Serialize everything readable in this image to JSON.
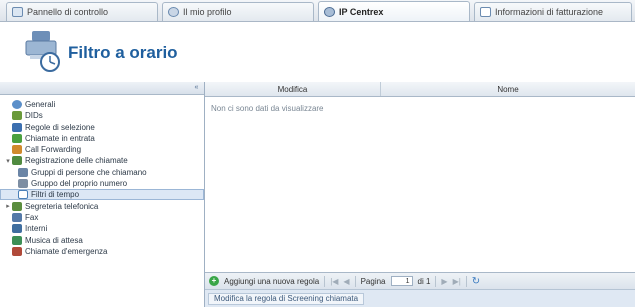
{
  "tabs": [
    {
      "label": "Pannello di controllo",
      "icon": "panel-icon",
      "active": false
    },
    {
      "label": "Il mio profilo",
      "icon": "user-icon",
      "active": false
    },
    {
      "label": "IP Centrex",
      "icon": "gear-icon",
      "active": true
    },
    {
      "label": "Informazioni di fatturazione",
      "icon": "info-icon",
      "active": false
    }
  ],
  "header": {
    "title": "Filtro a orario",
    "icon": "clock-filter-icon"
  },
  "sidebar": {
    "collapse_symbol": "«",
    "items": [
      {
        "label": "Generali",
        "icon": "globe-icon",
        "color": "#5b8fc9"
      },
      {
        "label": "DIDs",
        "icon": "phone-number-icon",
        "color": "#6a9a3a"
      },
      {
        "label": "Regole di selezione",
        "icon": "rules-icon",
        "color": "#3b6fb0"
      },
      {
        "label": "Chiamate in entrata",
        "icon": "incoming-call-icon",
        "color": "#4aa03f"
      },
      {
        "label": "Call Forwarding",
        "icon": "forward-icon",
        "color": "#d08a2c"
      },
      {
        "label": "Registrazione delle chiamate",
        "icon": "recording-icon",
        "color": "#4f8a3f",
        "toggle": "▾"
      },
      {
        "label": "Gruppi di persone che chiamano",
        "icon": "group-icon",
        "color": "#6b85a6"
      },
      {
        "label": "Gruppo del proprio numero",
        "icon": "grid-icon",
        "color": "#7d8ea3"
      },
      {
        "label": "Filtri di tempo",
        "icon": "clock-icon",
        "color": "#4a7fb8",
        "selected": true
      },
      {
        "label": "Segreteria telefonica",
        "icon": "voicemail-icon",
        "color": "#5a8d3e",
        "toggle": "▸"
      },
      {
        "label": "Fax",
        "icon": "fax-icon",
        "color": "#5479a8"
      },
      {
        "label": "Interni",
        "icon": "extensions-icon",
        "color": "#3f6e9f"
      },
      {
        "label": "Musica di attesa",
        "icon": "music-icon",
        "color": "#3c8f56"
      },
      {
        "label": "Chiamate d'emergenza",
        "icon": "emergency-icon",
        "color": "#b04a3a"
      }
    ]
  },
  "grid": {
    "columns": [
      "Modifica",
      "Nome"
    ],
    "empty_message": "Non ci sono dati da visualizzare"
  },
  "pager": {
    "add_label": "Aggiungi una nuova regola",
    "page_label": "Pagina",
    "page_value": "1",
    "of_label": "di 1",
    "first": "|◀",
    "prev": "◀",
    "next": "▶",
    "last": "▶|",
    "refresh": "↻"
  },
  "status": {
    "text": "Modifica la regola di Screening chiamata"
  },
  "colors": {
    "accent": "#1f5f9e",
    "selected_bg": "#dce7f5"
  }
}
